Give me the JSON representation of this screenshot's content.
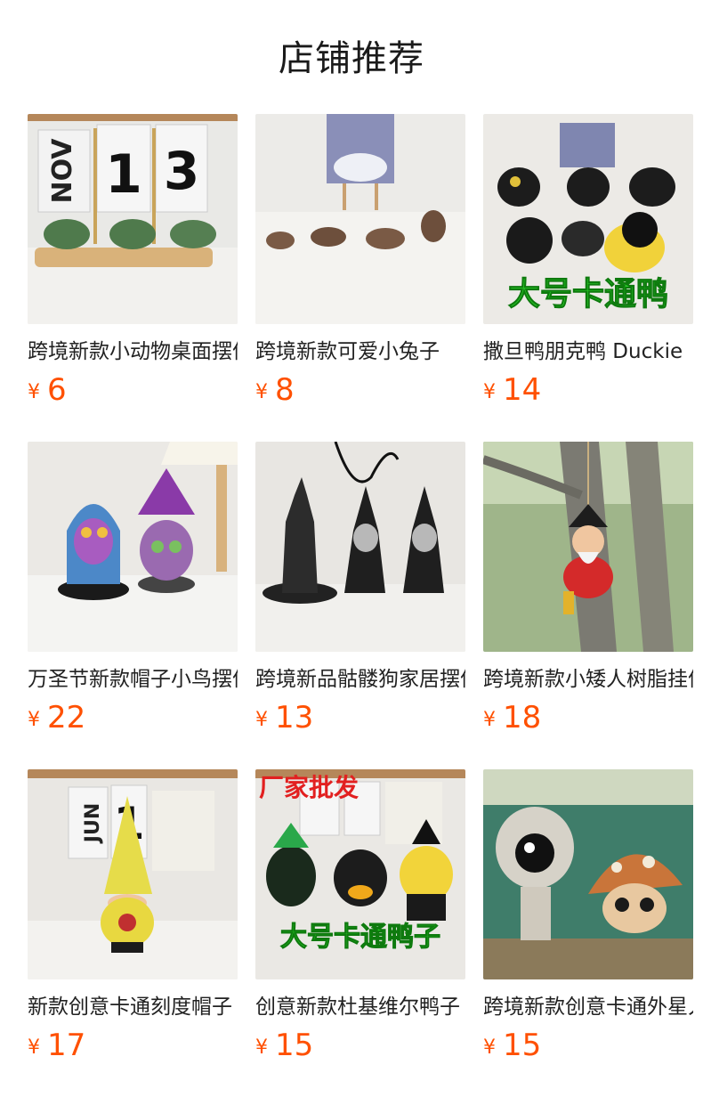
{
  "page": {
    "title": "店铺推荐"
  },
  "colors": {
    "price": "#ff5000",
    "text": "#222222"
  },
  "products": [
    {
      "name": "跨境新款小动物桌面摆件",
      "currency": "¥",
      "price": "6",
      "image": "rhino-figurines-calendar"
    },
    {
      "name": "跨境新款可爱小兔子",
      "currency": "¥",
      "price": "8",
      "image": "brown-otter-figurines"
    },
    {
      "name": "撒旦鸭朋克鸭 Duckie",
      "currency": "¥",
      "price": "14",
      "image": "black-punk-ducks",
      "overlay_text": "大号卡通鸭"
    },
    {
      "name": "万圣节新款帽子小鸟摆件",
      "currency": "¥",
      "price": "22",
      "image": "halloween-owl-cat"
    },
    {
      "name": "跨境新品骷髅狗家居摆件",
      "currency": "¥",
      "price": "13",
      "image": "skeleton-dog-gnomes"
    },
    {
      "name": "跨境新款小矮人树脂挂件",
      "currency": "¥",
      "price": "18",
      "image": "gnome-climbing-tree"
    },
    {
      "name": "新款创意卡通刻度帽子",
      "currency": "¥",
      "price": "17",
      "image": "yellow-hat-gnome"
    },
    {
      "name": "创意新款杜基维尔鸭子",
      "currency": "¥",
      "price": "15",
      "image": "punk-duck-trio",
      "badge_text": "厂家批发",
      "overlay_text": "大号卡通鸭子"
    },
    {
      "name": "跨境新款创意卡通外星人",
      "currency": "¥",
      "price": "15",
      "image": "alien-mushroom-figures"
    }
  ]
}
